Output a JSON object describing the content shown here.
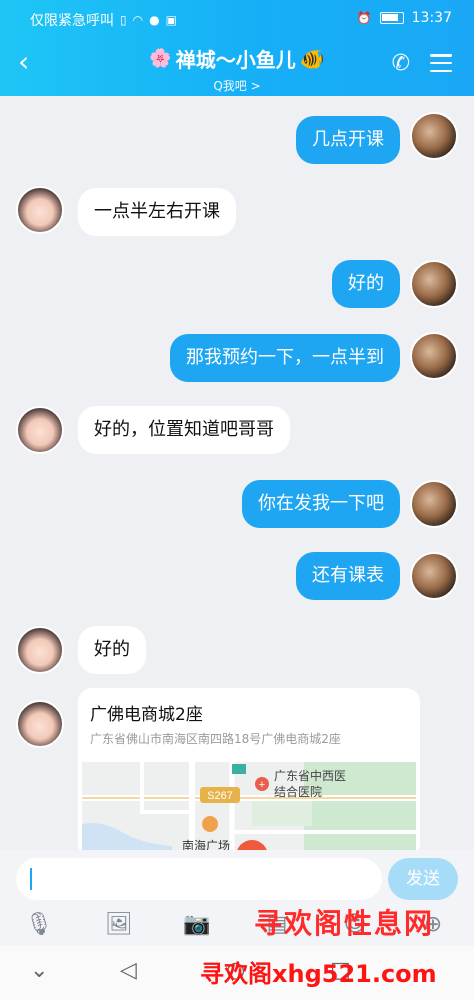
{
  "status_bar": {
    "carrier": "仅限紧急呼叫",
    "time": "13:37"
  },
  "header": {
    "title": "禅城～小鱼儿",
    "subtitle": "Q我吧 >"
  },
  "messages": [
    {
      "side": "me",
      "text": "几点开课"
    },
    {
      "side": "them",
      "text": "一点半左右开课"
    },
    {
      "side": "me",
      "text": "好的"
    },
    {
      "side": "me",
      "text": "那我预约一下，一点半到"
    },
    {
      "side": "them",
      "text": "好的，位置知道吧哥哥"
    },
    {
      "side": "me",
      "text": "你在发我一下吧"
    },
    {
      "side": "me",
      "text": "还有课表"
    },
    {
      "side": "them",
      "text": "好的"
    }
  ],
  "location_card": {
    "name": "广佛电商城2座",
    "address": "广东省佛山市南海区南四路18号广佛电商城2座",
    "map_labels": {
      "road": "S267",
      "hospital": "广东省中西医结合医院",
      "place": "南海广场"
    }
  },
  "input": {
    "value": "",
    "send_label": "发送"
  },
  "toolbar": {
    "icons": [
      "microphone-icon",
      "image-icon",
      "camera-icon",
      "red-packet-icon",
      "emoji-icon",
      "plus-icon"
    ]
  },
  "watermark": {
    "line1": "寻欢阁性息网",
    "line2": "寻欢阁xhg521.com"
  },
  "colors": {
    "header_start": "#1ec6f5",
    "header_end": "#1aa8f6",
    "my_bubble": "#1fa6f2",
    "their_bubble": "#ffffff",
    "send_button": "#a6dcf7"
  }
}
